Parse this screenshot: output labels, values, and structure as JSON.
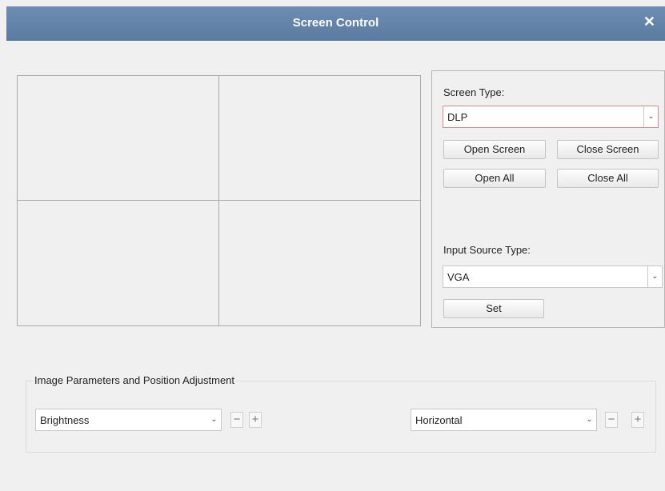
{
  "window": {
    "title": "Screen Control",
    "close_glyph": "✕"
  },
  "panel": {
    "screen_type_label": "Screen Type:",
    "screen_type_value": "DLP",
    "buttons": {
      "open_screen": "Open Screen",
      "close_screen": "Close Screen",
      "open_all": "Open All",
      "close_all": "Close All",
      "set": "Set"
    },
    "input_source_label": "Input Source Type:",
    "input_source_value": "VGA"
  },
  "adjust": {
    "title": "Image Parameters and Position Adjustment",
    "param_value": "Brightness",
    "position_value": "Horizontal",
    "minus": "−",
    "plus": "+"
  },
  "icons": {
    "dropdown": "chevron-down-icon",
    "close": "close-icon"
  },
  "colors": {
    "titlebar": "#5f7ea3",
    "active_border": "#d98a8a",
    "background": "#f0f0f0"
  }
}
